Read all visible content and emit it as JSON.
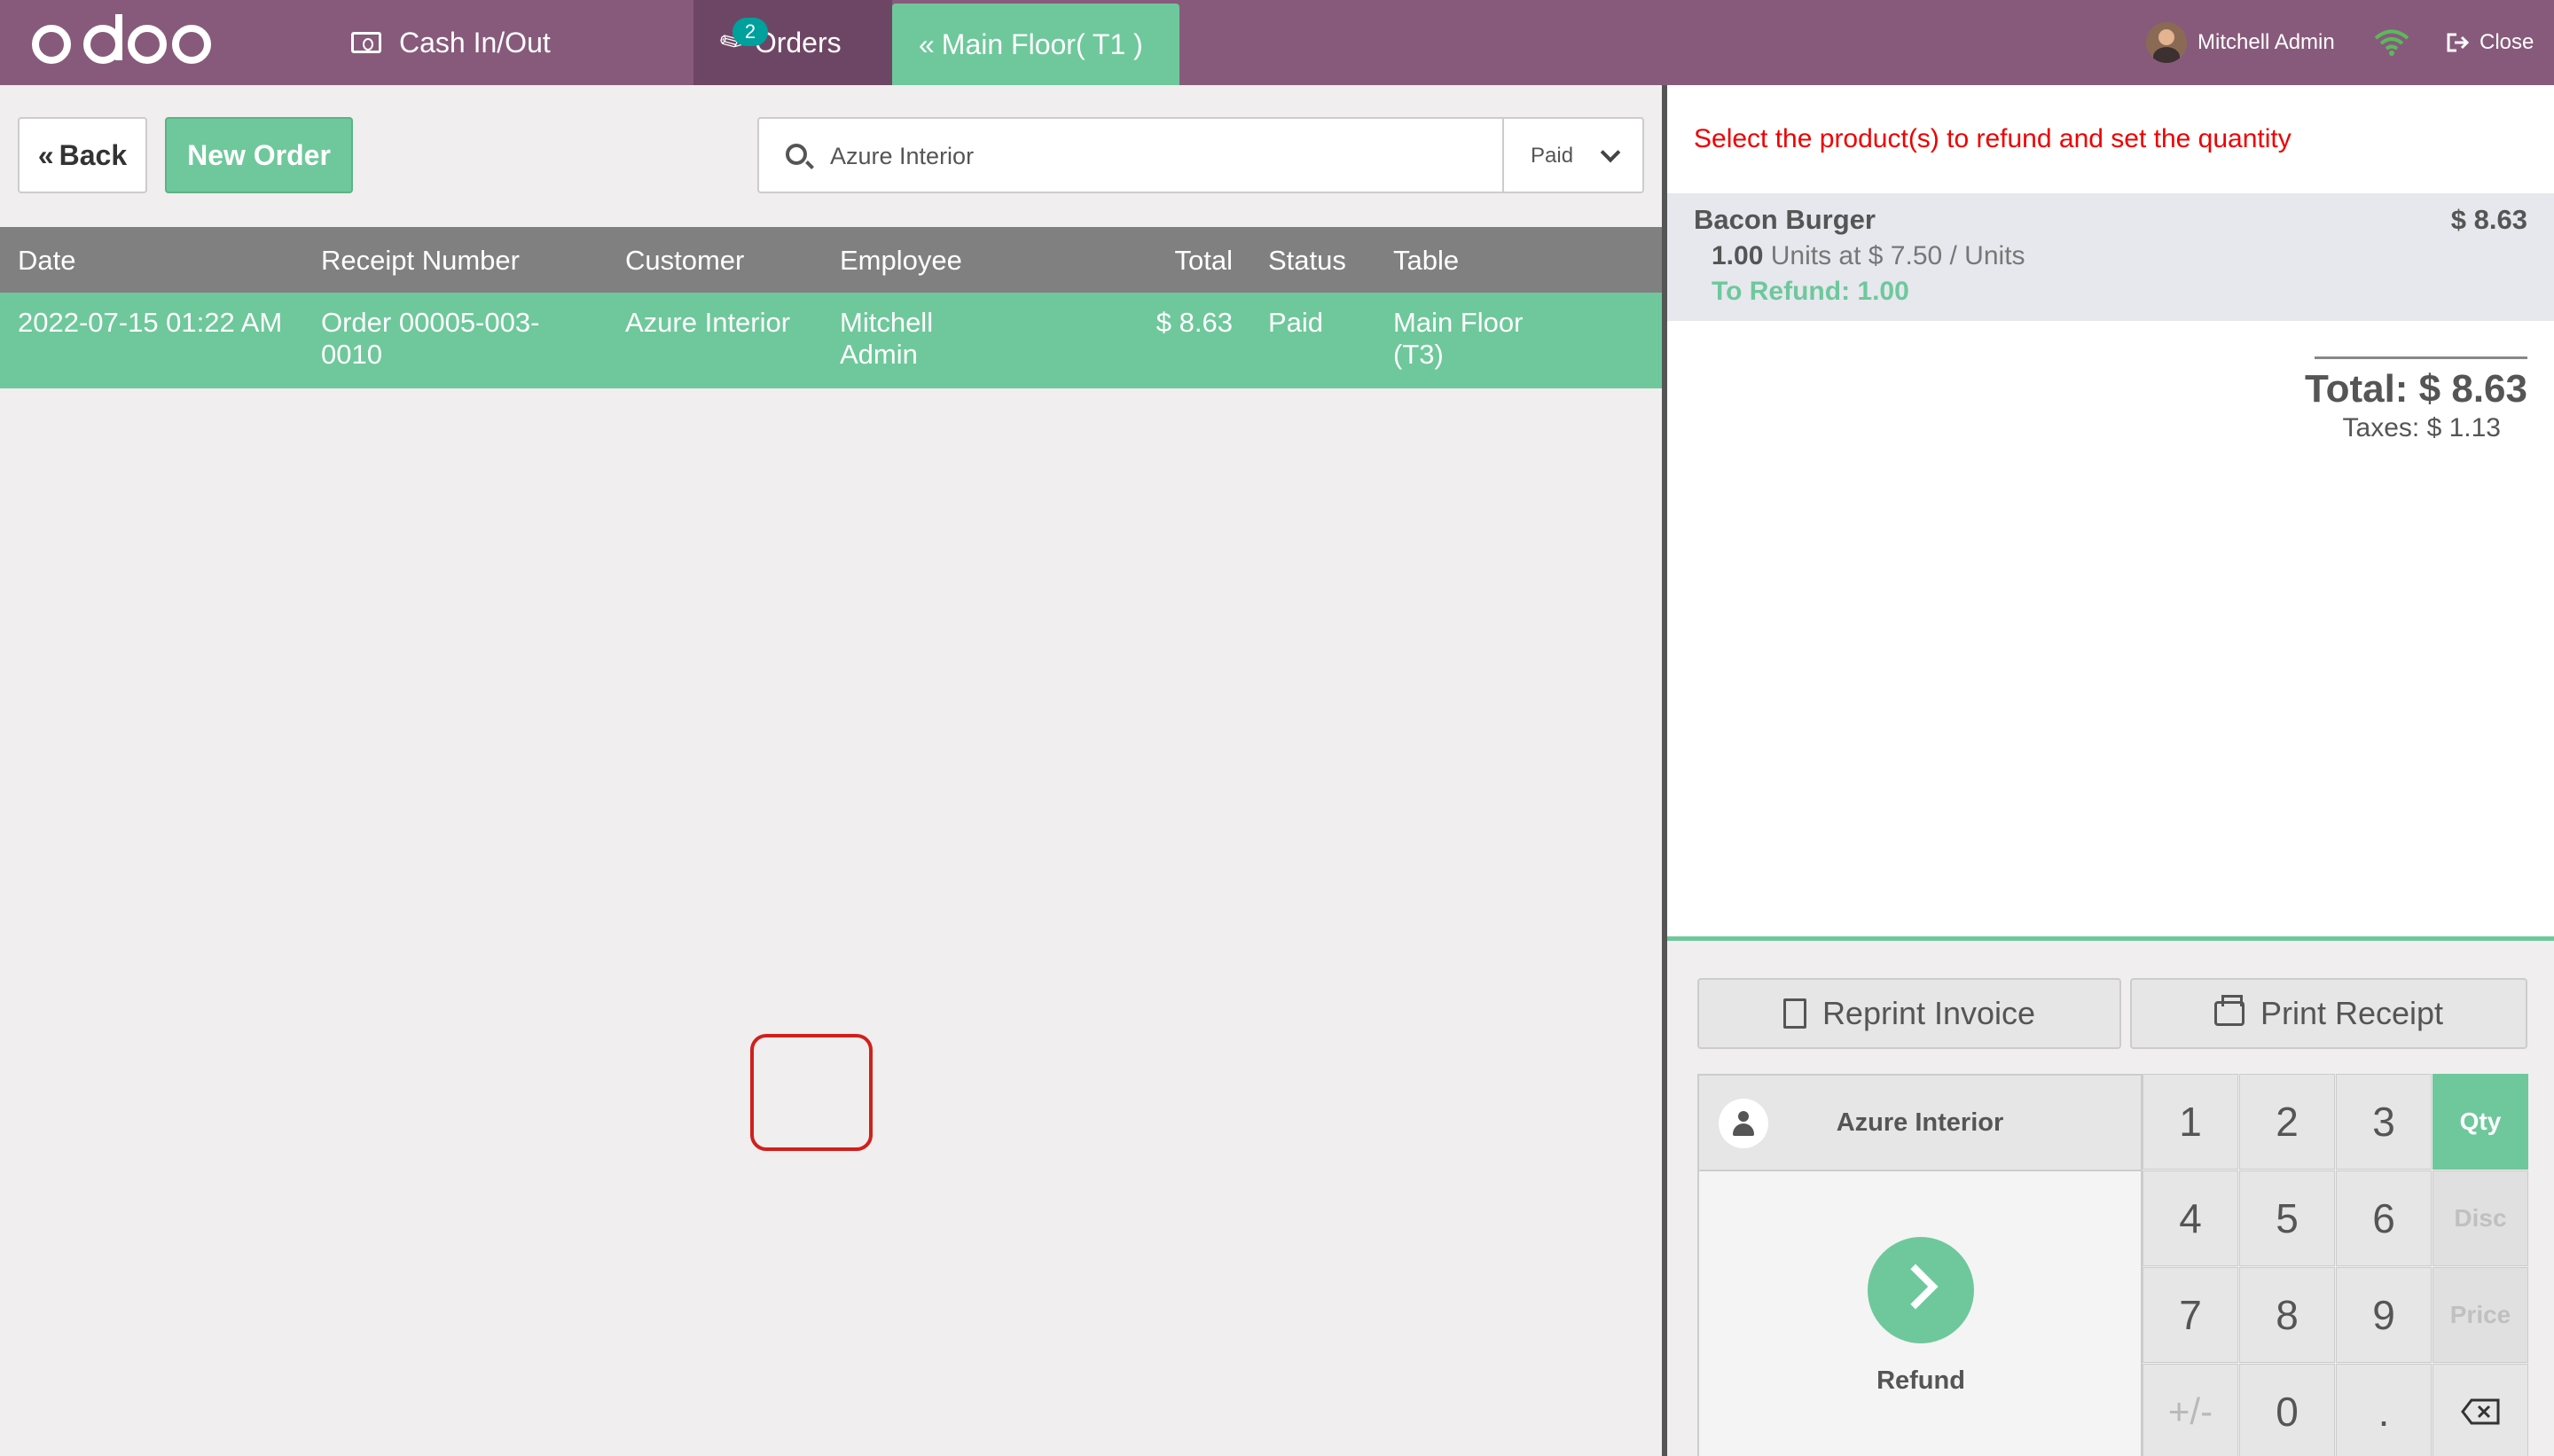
{
  "topbar": {
    "cash_label": "Cash In/Out",
    "orders_label": "Orders",
    "orders_badge": "2",
    "floor_label": "Main Floor( T1 )",
    "user_name": "Mitchell Admin",
    "close_label": "Close",
    "colors": {
      "bar": "#875a7b",
      "accent": "#6ec89b",
      "badge": "#00a09d"
    }
  },
  "toolbar": {
    "back_label": "Back",
    "new_order_label": "New Order",
    "search_value": "Azure Interior",
    "filter_value": "Paid"
  },
  "table": {
    "columns": [
      "Date",
      "Receipt Number",
      "Customer",
      "Employee",
      "Total",
      "Status",
      "Table"
    ],
    "rows": [
      {
        "date": "2022-07-15 01:22 AM",
        "receipt": "Order 00005-003-0010",
        "customer": "Azure Interior",
        "employee": "Mitchell Admin",
        "total": "$ 8.63",
        "status": "Paid",
        "table": "Main Floor (T3)"
      }
    ]
  },
  "refund": {
    "hint": "Select the product(s) to refund and set the quantity",
    "line": {
      "name": "Bacon Burger",
      "price": "$ 8.63",
      "qty": "1.00",
      "unit_info": "Units at $ 7.50 / Units",
      "to_refund": "To Refund: 1.00"
    },
    "total": "Total: $ 8.63",
    "taxes": "Taxes: $ 1.13"
  },
  "actions": {
    "reprint_invoice": "Reprint Invoice",
    "print_receipt": "Print Receipt",
    "customer": "Azure Interior",
    "pay_label": "Refund"
  },
  "numpad": {
    "k1": "1",
    "k2": "2",
    "k3": "3",
    "k4": "4",
    "k5": "5",
    "k6": "6",
    "k7": "7",
    "k8": "8",
    "k9": "9",
    "ksign": "+/-",
    "k0": "0",
    "kdot": ".",
    "qty": "Qty",
    "disc": "Disc",
    "price": "Price"
  }
}
